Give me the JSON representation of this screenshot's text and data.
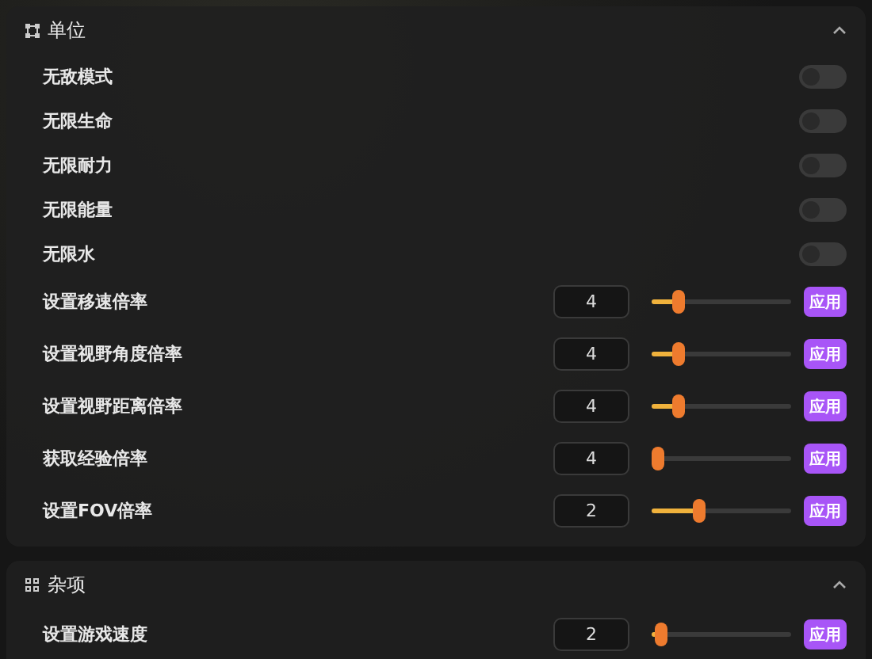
{
  "sections": [
    {
      "title": "单位",
      "expanded": true,
      "items": [
        {
          "kind": "toggle",
          "label": "无敌模式",
          "on": false
        },
        {
          "kind": "toggle",
          "label": "无限生命",
          "on": false
        },
        {
          "kind": "toggle",
          "label": "无限耐力",
          "on": false
        },
        {
          "kind": "toggle",
          "label": "无限能量",
          "on": false
        },
        {
          "kind": "toggle",
          "label": "无限水",
          "on": false
        },
        {
          "kind": "slider",
          "label": "设置移速倍率",
          "value": "4",
          "level": 0.16,
          "button": "应用"
        },
        {
          "kind": "slider",
          "label": "设置视野角度倍率",
          "value": "4",
          "level": 0.16,
          "button": "应用"
        },
        {
          "kind": "slider",
          "label": "设置视野距离倍率",
          "value": "4",
          "level": 0.16,
          "button": "应用"
        },
        {
          "kind": "slider",
          "label": "获取经验倍率",
          "value": "4",
          "level": 0,
          "button": "应用"
        },
        {
          "kind": "slider",
          "label": "设置FOV倍率",
          "value": "2",
          "level": 0.33,
          "button": "应用"
        }
      ]
    },
    {
      "title": "杂项",
      "expanded": true,
      "items": [
        {
          "kind": "slider",
          "label": "设置游戏速度",
          "value": "2",
          "level": 0.02,
          "button": "应用"
        }
      ]
    }
  ]
}
